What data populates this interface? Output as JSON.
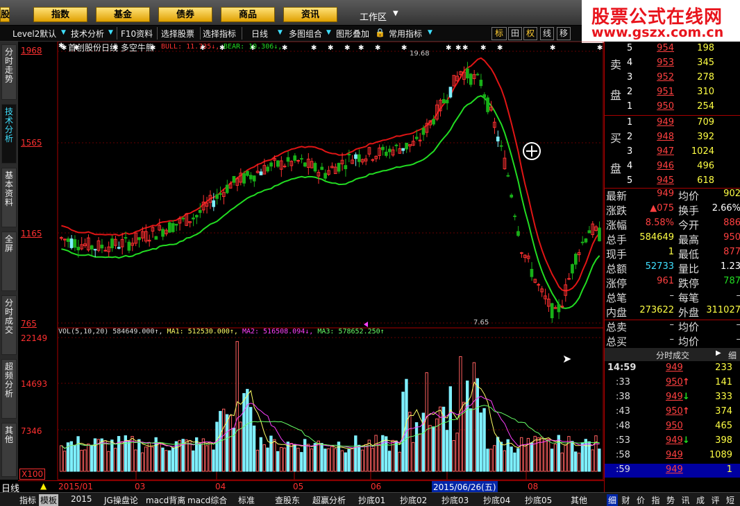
{
  "topnav": {
    "partial_left": "股",
    "buttons": [
      "指数",
      "基金",
      "债券",
      "商品",
      "资讯"
    ],
    "workspace": "工作区"
  },
  "logo": {
    "line1": "股票公式在线网",
    "line2": "www.gszx.com.cn"
  },
  "toolbar": {
    "items": [
      "Level2默认",
      "技术分析",
      "F10资料",
      "选择股票",
      "选择指标",
      "日线",
      "多图组合",
      "图形叠加",
      "常用指标"
    ],
    "right_buttons": [
      "标",
      "田",
      "权",
      "线",
      "移"
    ]
  },
  "left_tabs": [
    "分时走势",
    "技术分析",
    "基本资料",
    "全屏",
    "分时成交",
    "超频分析",
    "其他"
  ],
  "chart": {
    "title": "首创股份日线  多空牛熊",
    "bull_label": "BULL: 11.735↓,",
    "bear_label": "BEAR: 10.306↓,",
    "price_axis": [
      "1968",
      "1565",
      "1165",
      "765"
    ],
    "high_label": "19.68",
    "low_label": "7.65",
    "vol_axis": [
      "22149",
      "14693",
      "7346"
    ],
    "vol_unit": "X100",
    "vol_info": {
      "vol": "VOL(5,10,20) 584649.000↑,",
      "ma1": "MA1: 512530.000↑,",
      "ma2": "MA2: 516508.094↓,",
      "ma3": "MA3: 578652.250↑"
    },
    "x_axis": [
      "2015/01",
      "03",
      "04",
      "05",
      "06",
      "08"
    ],
    "cursor_date": "2015/06/26(五)",
    "period": "日线"
  },
  "chart_data": {
    "type": "candlestick",
    "title": "首创股份日线",
    "indicator": "多空牛熊",
    "price_range": [
      7.65,
      19.68
    ],
    "volume_range": [
      0,
      22149
    ]
  },
  "colors": {
    "up": "#ff3030",
    "down": "#18b018",
    "bull": "#e01515",
    "bear": "#22dd22",
    "vol_up": "#ff6060",
    "vol_down": "#7ff0ff"
  },
  "orderbook": {
    "sell_label": "卖",
    "sell_label2": "盘",
    "buy_label": "买",
    "buy_label2": "盘",
    "sell": [
      {
        "n": "5",
        "p": "954",
        "v": "198"
      },
      {
        "n": "4",
        "p": "953",
        "v": "345"
      },
      {
        "n": "3",
        "p": "952",
        "v": "278"
      },
      {
        "n": "2",
        "p": "951",
        "v": "310"
      },
      {
        "n": "1",
        "p": "950",
        "v": "254"
      }
    ],
    "buy": [
      {
        "n": "1",
        "p": "949",
        "v": "709"
      },
      {
        "n": "2",
        "p": "948",
        "v": "392"
      },
      {
        "n": "3",
        "p": "947",
        "v": "1024"
      },
      {
        "n": "4",
        "p": "946",
        "v": "496"
      },
      {
        "n": "5",
        "p": "945",
        "v": "618"
      }
    ]
  },
  "quote": {
    "rows": [
      {
        "l1": "最新",
        "v1": "949",
        "l2": "均价",
        "v2": "902"
      },
      {
        "l1": "涨跌",
        "v1": "▲075",
        "l2": "换手",
        "v2": "2.66%"
      },
      {
        "l1": "涨幅",
        "v1": "8.58%",
        "l2": "今开",
        "v2": "886"
      },
      {
        "l1": "总手",
        "v1": "584649",
        "l2": "最高",
        "v2": "950"
      },
      {
        "l1": "现手",
        "v1": "1",
        "l2": "最低",
        "v2": "877"
      },
      {
        "l1": "总额",
        "v1": "52733",
        "l2": "量比",
        "v2": "1.23"
      },
      {
        "l1": "涨停",
        "v1": "961",
        "l2": "跌停",
        "v2": "787"
      },
      {
        "l1": "总笔",
        "v1": "–",
        "l2": "每笔",
        "v2": "–"
      },
      {
        "l1": "内盘",
        "v1": "273622",
        "l2": "外盘",
        "v2": "311027"
      },
      {
        "l1": "总卖",
        "v1": "–",
        "l2": "均价",
        "v2": "–"
      },
      {
        "l1": "总买",
        "v1": "–",
        "l2": "均价",
        "v2": "–"
      }
    ]
  },
  "ticks": {
    "title": "分时成交",
    "detail": "细",
    "rows": [
      {
        "t": "14:59",
        "p": "949",
        "a": "",
        "v": "233"
      },
      {
        "t": ":33",
        "p": "950",
        "a": "↑",
        "v": "141"
      },
      {
        "t": ":38",
        "p": "949",
        "a": "↓",
        "v": "333"
      },
      {
        "t": ":43",
        "p": "950",
        "a": "↑",
        "v": "374"
      },
      {
        "t": ":48",
        "p": "950",
        "a": "",
        "v": "465"
      },
      {
        "t": ":53",
        "p": "949",
        "a": "↓",
        "v": "398"
      },
      {
        "t": ":58",
        "p": "949",
        "a": "",
        "v": "1089"
      },
      {
        "t": ":59",
        "p": "949",
        "a": "",
        "v": "1"
      }
    ]
  },
  "bottom": {
    "left": [
      "指标",
      "模板"
    ],
    "tabs": [
      "2015",
      "JG操盘论",
      "macd背离",
      "macd综合",
      "标准",
      "查股东",
      "超赢分析",
      "抄底01",
      "抄底02",
      "抄底03",
      "抄底04",
      "抄底05",
      "其他"
    ],
    "right": [
      "细",
      "财",
      "价",
      "指",
      "势",
      "讯",
      "成",
      "评",
      "短"
    ]
  }
}
